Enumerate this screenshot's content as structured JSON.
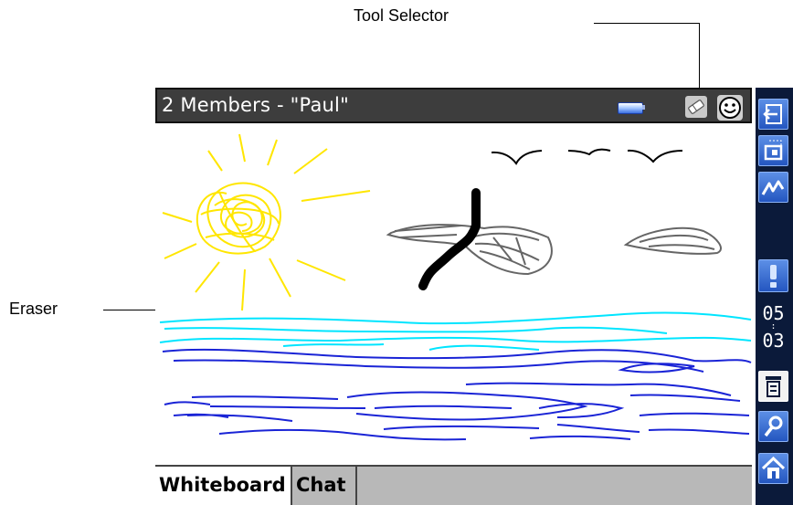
{
  "annotations": {
    "tool_selector": "Tool Selector",
    "eraser": "Eraser"
  },
  "titlebar": {
    "title": "2 Members - \"Paul\""
  },
  "tabs": [
    {
      "label": "Whiteboard",
      "selected": true
    },
    {
      "label": "Chat",
      "selected": false
    }
  ],
  "status": {
    "clock_hour": "05",
    "clock_minute": "03"
  },
  "sidebar_icons": [
    "exit-icon",
    "window-icon",
    "draw-icon",
    "alert-icon",
    "menu-icon",
    "search-icon",
    "home-icon"
  ],
  "colors": {
    "titlebar": "#3d3d3d",
    "sidebar": "#0b1a3a",
    "sun": "#ffe600",
    "water_light": "#00e5ff",
    "water_dark": "#1a24d6",
    "stroke": "#000000"
  }
}
